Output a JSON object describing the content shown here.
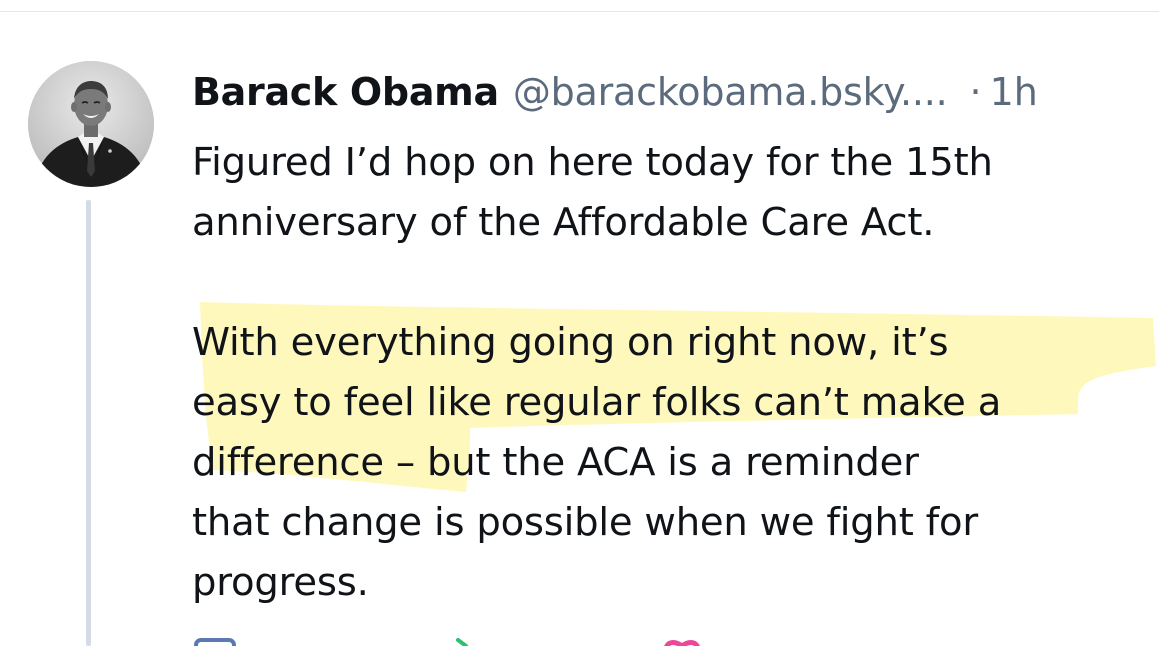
{
  "post": {
    "author": {
      "display_name": "Barack Obama",
      "handle": "@barackobama.bsky....",
      "avatar_icon": "avatar-photo"
    },
    "separator": "·",
    "timestamp": "1h",
    "text_lines": [
      "Figured I’d hop on here today for the 15th",
      "anniversary of the Affordable Care Act.",
      "",
      "With everything going on right now, it’s",
      "easy to feel like regular folks can’t make a",
      "difference – but the ACA is a reminder",
      "that change is possible when we fight for",
      "progress."
    ],
    "highlight_color": "#fff7b0",
    "actions": {
      "reply_icon": "reply-icon",
      "repost_icon": "repost-icon",
      "like_icon": "heart-icon"
    }
  },
  "colors": {
    "text": "#101418",
    "muted": "#5b6b7d",
    "thread_line": "#d5dbe6",
    "reply_icon": "#5b7bb0",
    "repost_icon": "#2fbf71",
    "like_icon": "#ec4899"
  }
}
